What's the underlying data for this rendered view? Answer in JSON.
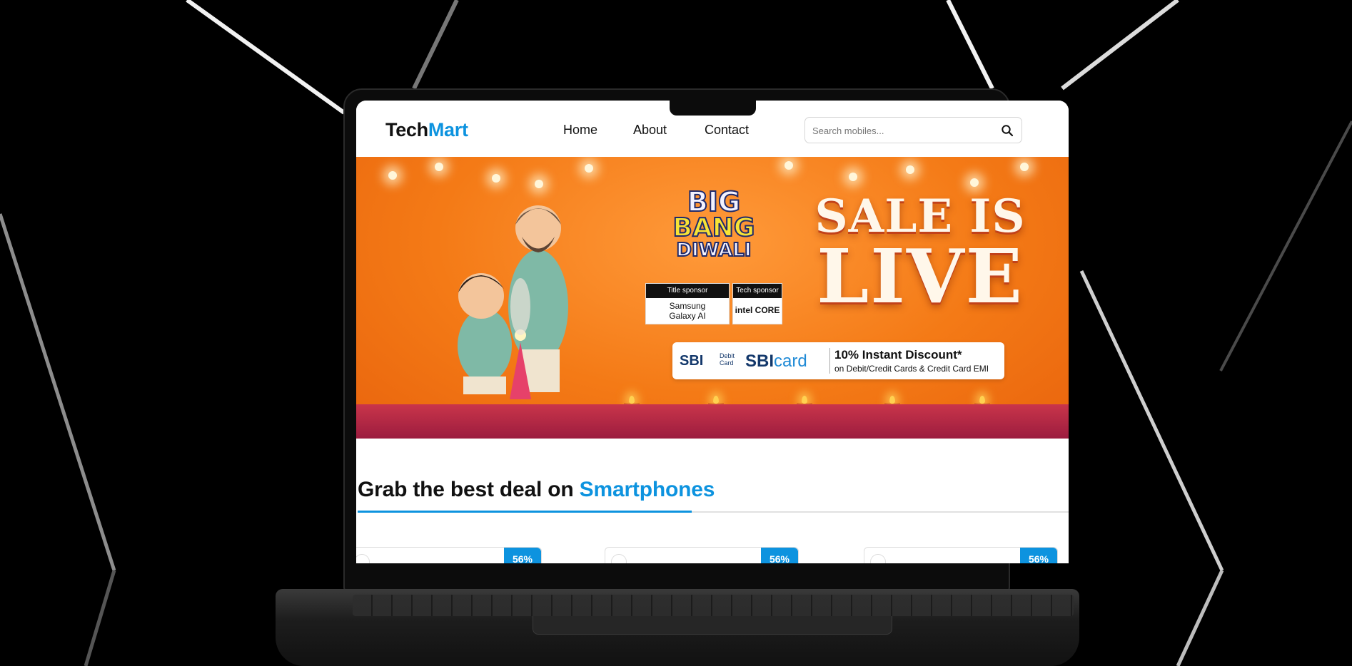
{
  "header": {
    "logo_main": "Tech",
    "logo_accent": "Mart",
    "nav": [
      "Home",
      "About",
      "Contact"
    ],
    "search_placeholder": "Search mobiles..."
  },
  "banner": {
    "bang_line1": "BIG",
    "bang_line2": "BANG",
    "bang_line3": "DIWALI",
    "sale_line1": "SALE IS",
    "sale_line2": "LIVE",
    "title_sponsor_label": "Title sponsor",
    "title_sponsor_name_1": "Samsung",
    "title_sponsor_name_2": "Galaxy AI",
    "tech_sponsor_label": "Tech sponsor",
    "tech_sponsor_name": "intel CORE",
    "sbi_debit": "SBI",
    "sbi_debit_sub": "Debit Card",
    "sbi_card_bold": "SBI",
    "sbi_card_text": "card",
    "offer_title": "10% Instant Discount*",
    "offer_sub": "on Debit/Credit Cards & Credit Card EMI"
  },
  "section": {
    "title_main": "Grab the best deal on ",
    "title_accent": "Smartphones"
  },
  "products": [
    {
      "discount": "56%"
    },
    {
      "discount": "56%"
    },
    {
      "discount": "56%"
    }
  ],
  "colors": {
    "accent": "#0d93df",
    "banner_orange": "#f47a16",
    "background": "#000000"
  },
  "icons": [
    "search-icon",
    "heart-icon"
  ]
}
